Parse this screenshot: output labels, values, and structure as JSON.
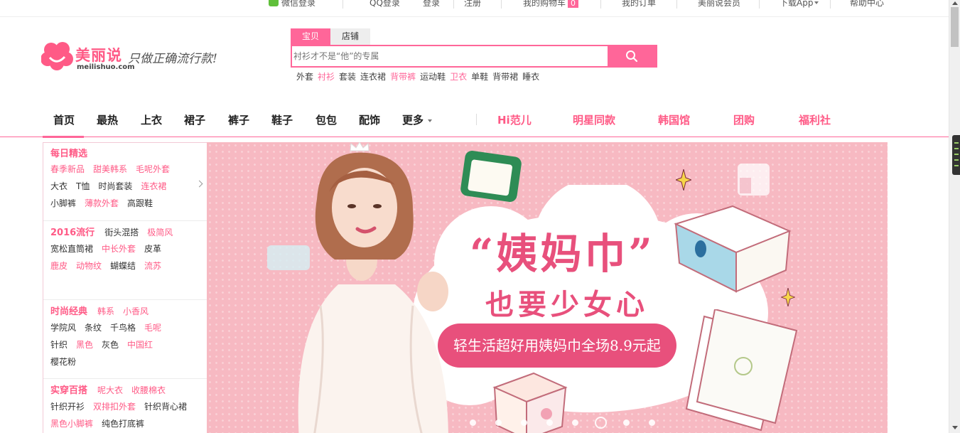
{
  "topbar": {
    "wechat_login": "微信登录",
    "qq_login": "QQ登录",
    "login": "登录",
    "register": "注册",
    "cart": "我的购物车",
    "cart_count": "0",
    "orders": "我的订单",
    "member": "美丽说会员",
    "download_app": "下载App",
    "help": "帮助中心"
  },
  "logo": {
    "brand_cn": "美丽说",
    "brand_en": "meilishuo.com",
    "slogan": "只做正确流行款!"
  },
  "search": {
    "tab_active": "宝贝",
    "tab_inactive": "店铺",
    "placeholder": "衬衫才不是“他”的专属",
    "hotwords": [
      {
        "text": "外套",
        "highlight": false
      },
      {
        "text": "衬衫",
        "highlight": true
      },
      {
        "text": "套装",
        "highlight": false
      },
      {
        "text": "连衣裙",
        "highlight": false
      },
      {
        "text": "背带裤",
        "highlight": true
      },
      {
        "text": "运动鞋",
        "highlight": false
      },
      {
        "text": "卫衣",
        "highlight": true
      },
      {
        "text": "单鞋",
        "highlight": false
      },
      {
        "text": "背带裙",
        "highlight": false
      },
      {
        "text": "睡衣",
        "highlight": false
      }
    ]
  },
  "nav": {
    "items": [
      "首页",
      "最热",
      "上衣",
      "裙子",
      "裤子",
      "鞋子",
      "包包",
      "配饰",
      "更多"
    ],
    "featured": [
      "Hi范儿",
      "明星同款",
      "韩国馆",
      "团购",
      "福利社"
    ]
  },
  "sidebar": {
    "c1": {
      "title": "每日精选",
      "r1": [
        "春季新品",
        "甜美韩系",
        "毛呢外套"
      ],
      "r2": [
        "大衣",
        "T恤",
        "时尚套装",
        "连衣裙"
      ],
      "r3": [
        "小脚裤",
        "薄款外套",
        "高跟鞋"
      ]
    },
    "c2": {
      "title": "2016流行",
      "r1": [
        "街头混搭",
        "极简风"
      ],
      "r2": [
        "宽松直筒裙",
        "中长外套",
        "皮革"
      ],
      "r3": [
        "鹿皮",
        "动物纹",
        "蝴蝶结",
        "流苏"
      ]
    },
    "c3": {
      "title": "时尚经典",
      "r1": [
        "韩系",
        "小香风"
      ],
      "r2": [
        "学院风",
        "条纹",
        "千鸟格",
        "毛呢"
      ],
      "r3": [
        "针织",
        "黑色",
        "灰色",
        "中国红"
      ],
      "r4": [
        "樱花粉"
      ]
    },
    "c4": {
      "title": "实穿百搭",
      "r1": [
        "呢大衣",
        "收腰棉衣"
      ],
      "r2": [
        "针织开衫",
        "双排扣外套",
        "针织背心裙"
      ],
      "r3": [
        "黑色小脚裤",
        "纯色打底裤"
      ]
    }
  },
  "banner": {
    "headline1": "“姨妈巾”",
    "headline2": "也要少女心",
    "promo": "轻生活超好用姨妈巾全场8.9元起",
    "slide_count": 8,
    "active_slide": 6
  },
  "colors": {
    "accent": "#ff6699",
    "banner_bg": "#f7b9c2",
    "headline": "#e8507c"
  }
}
